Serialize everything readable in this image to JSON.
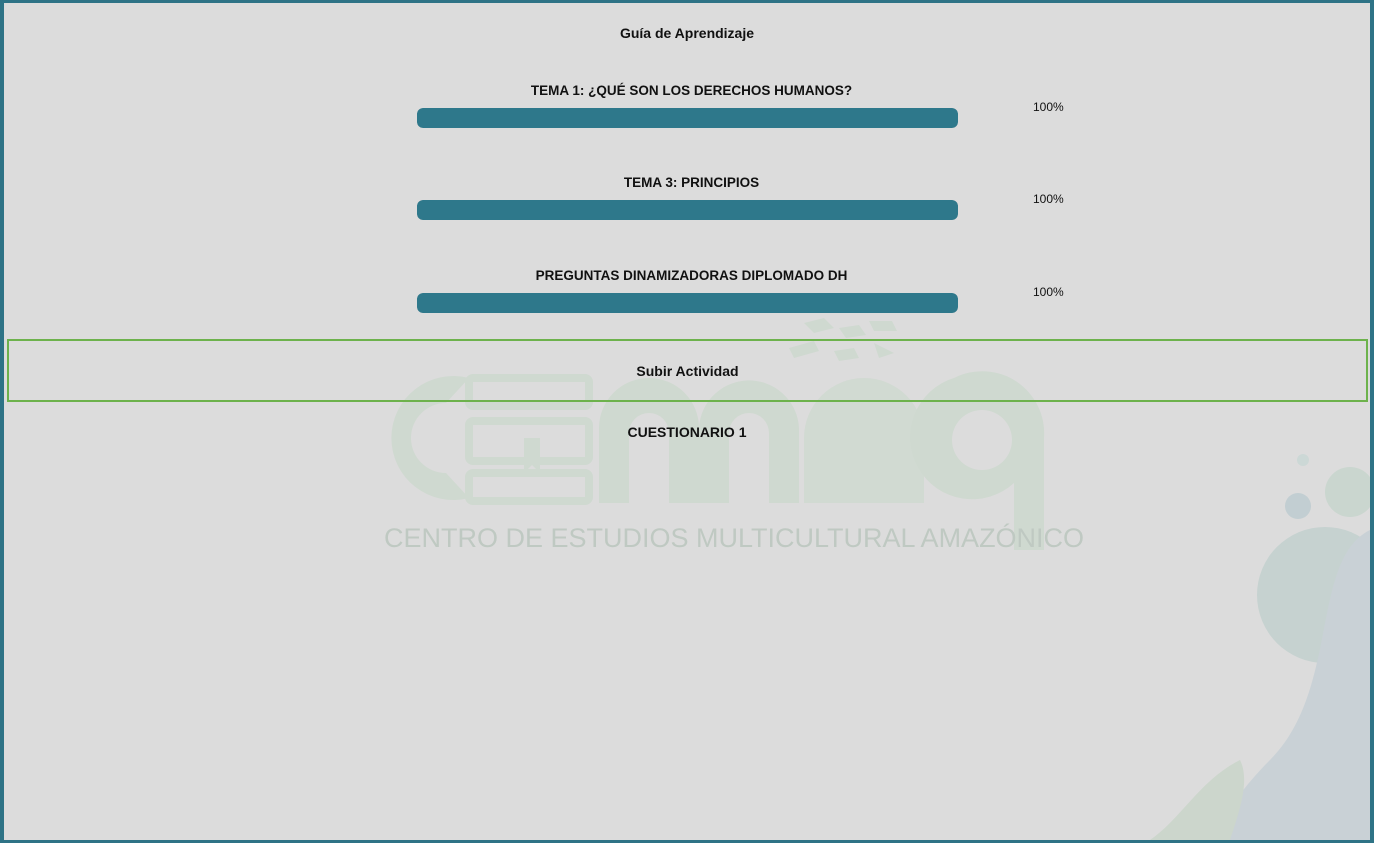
{
  "page_title": "Guía de Aprendizaje",
  "topics": [
    {
      "label": "TEMA 1: ¿QUÉ SON LOS DERECHOS HUMANOS?",
      "progress": 100,
      "progress_text": "100%"
    },
    {
      "label": "TEMA 3: PRINCIPIOS",
      "progress": 100,
      "progress_text": "100%"
    },
    {
      "label": "PREGUNTAS DINAMIZADORAS DIPLOMADO DH",
      "progress": 100,
      "progress_text": "100%"
    }
  ],
  "upload_label": "Subir Actividad",
  "quiz_label": "CUESTIONARIO 1",
  "watermark": {
    "logo_text": "cemaq",
    "subtitle": "CENTRO DE ESTUDIOS MULTICULTURAL AMAZÓNICO"
  },
  "colors": {
    "border": "#2e7386",
    "progress_fill": "#2e788b",
    "upload_border": "#6db24c",
    "background": "#dcdcdc"
  }
}
